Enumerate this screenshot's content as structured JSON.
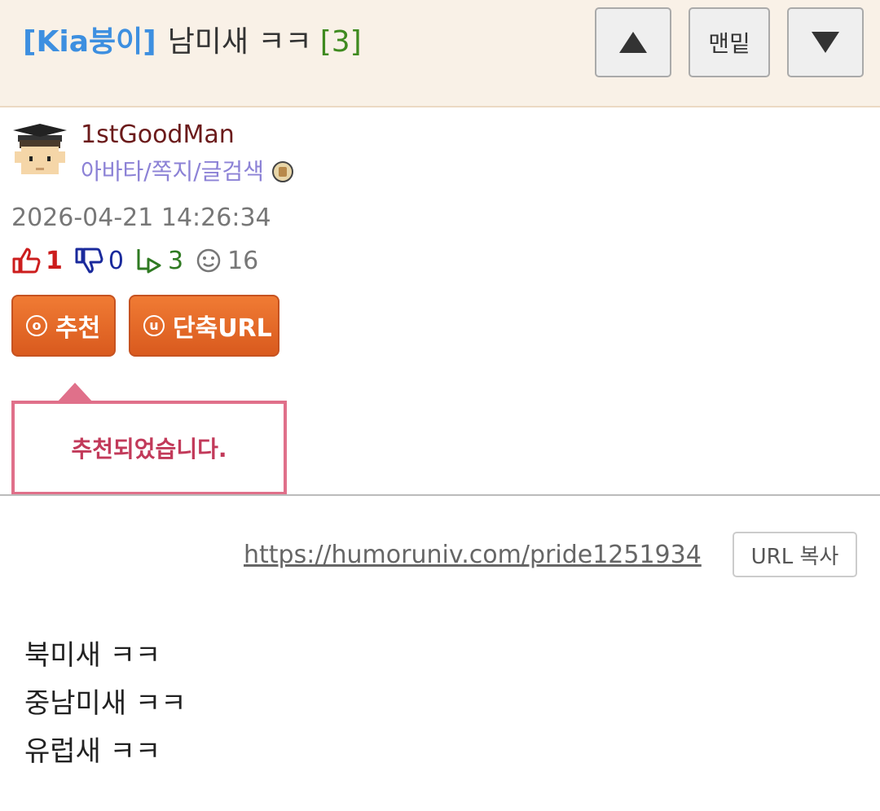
{
  "header": {
    "category": "[Kia붕이]",
    "title": "남미새 ㅋㅋ",
    "comment_count": "[3]",
    "nav": {
      "up_icon": "triangle-up-icon",
      "bottom_label": "맨밑",
      "down_icon": "triangle-down-icon"
    }
  },
  "author": {
    "name": "1stGoodMan",
    "links": "아바타/쪽지/글검색",
    "avatar_icon": "graduate-avatar-icon",
    "badge_icon": "level-badge-icon"
  },
  "post": {
    "date": "2026-04-21 14:26:34",
    "stats": {
      "upvotes": "1",
      "downvotes": "0",
      "replies": "3",
      "views": "16"
    }
  },
  "actions": {
    "recommend_key": "o",
    "recommend_label": "추천",
    "shorturl_key": "u",
    "shorturl_label": "단축URL"
  },
  "tooltip": {
    "message": "추천되었습니다."
  },
  "url": {
    "link": "https://humoruniv.com/pride1251934",
    "copy_label": "URL 복사"
  },
  "content": {
    "lines": [
      "북미새 ㅋㅋ",
      "중남미새 ㅋㅋ",
      "유럽새 ㅋㅋ"
    ]
  },
  "colors": {
    "header_bg": "#f9f1e7",
    "category": "#3d8fe0",
    "comment_count": "#3f8a1f",
    "action_button": "#e0662a",
    "tooltip_border": "#e0708a"
  }
}
